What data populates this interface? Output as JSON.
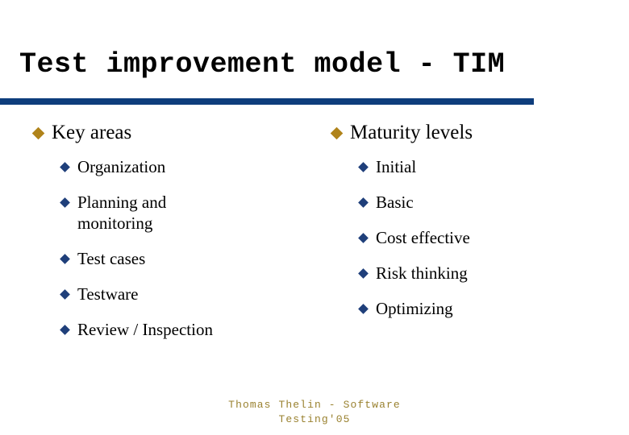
{
  "slide": {
    "title": "Test improvement model - TIM",
    "background_color": "#ffffff",
    "accent_rule_color": "#0e3d7c",
    "level1_bullet_color": "#b0831a",
    "level2_bullet_color": "#1f3f7a",
    "text_color": "#000000",
    "footer_color": "#9a8230"
  },
  "columns": {
    "left": {
      "heading": "Key areas",
      "items": [
        {
          "label": "Organization"
        },
        {
          "label": "Planning and\nmonitoring"
        },
        {
          "label": "Test cases"
        },
        {
          "label": "Testware"
        },
        {
          "label": "Review / Inspection"
        }
      ]
    },
    "right": {
      "heading": "Maturity levels",
      "items": [
        {
          "label": "Initial"
        },
        {
          "label": "Basic"
        },
        {
          "label": "Cost effective"
        },
        {
          "label": "Risk thinking"
        },
        {
          "label": "Optimizing"
        }
      ]
    }
  },
  "footer": {
    "line1": "Thomas Thelin - Software",
    "line2": "Testing'05"
  }
}
